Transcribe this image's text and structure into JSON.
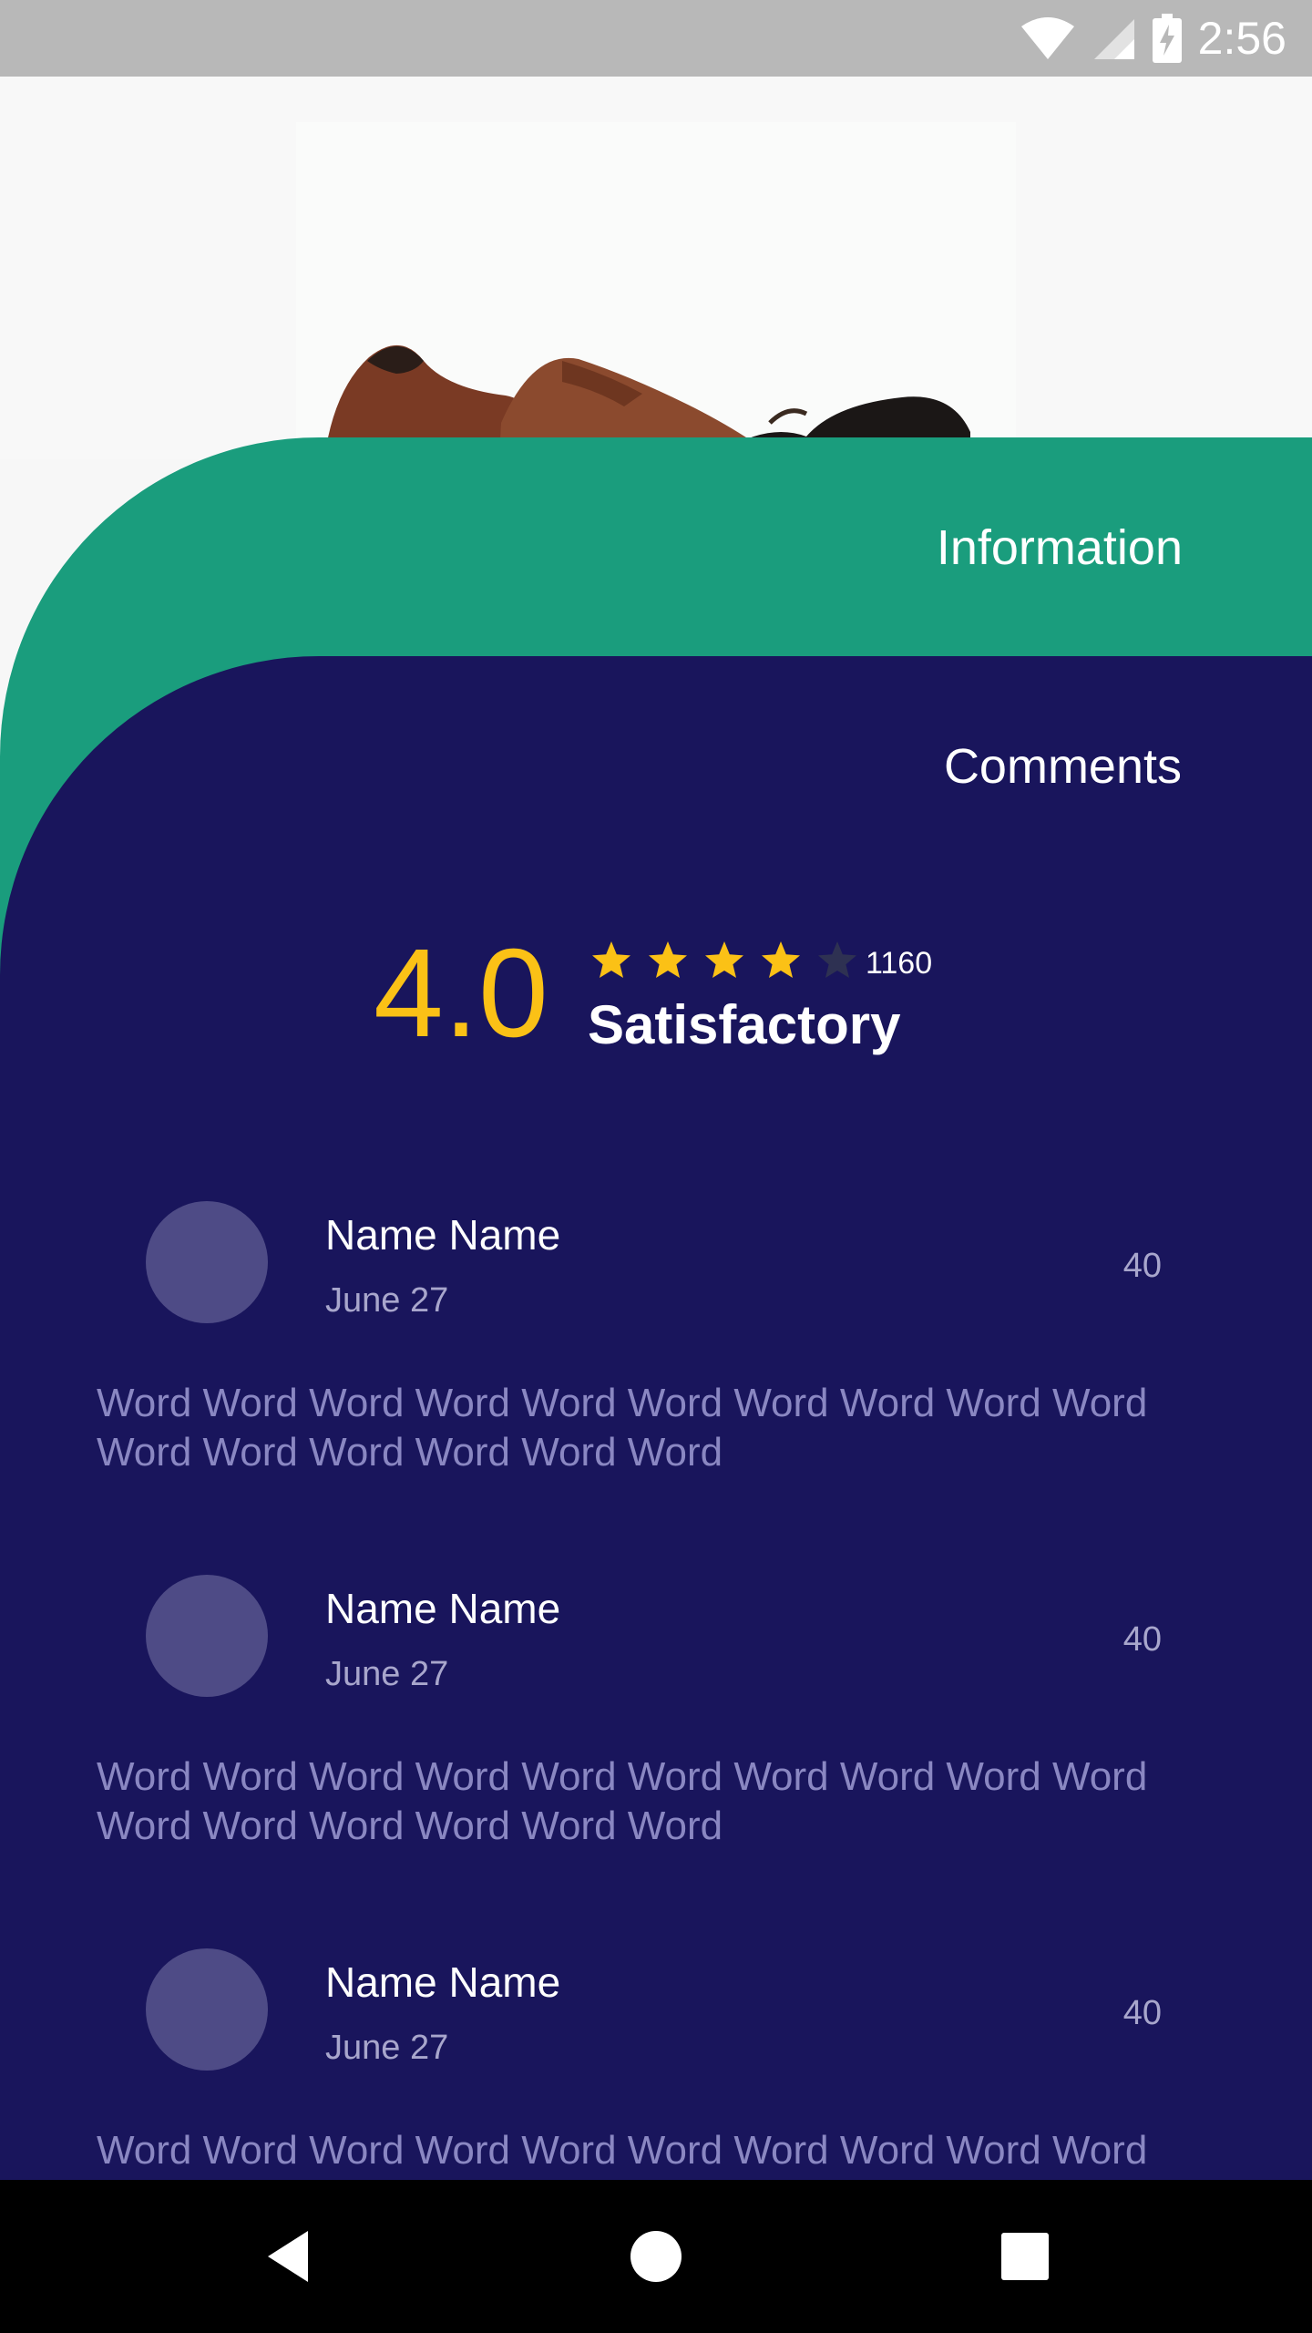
{
  "status_bar": {
    "time": "2:56",
    "icons": [
      "wifi-icon",
      "signal-icon",
      "battery-charging-icon"
    ]
  },
  "product": {
    "image": "brown-leather-shoes-image"
  },
  "tabs": {
    "information": "Information",
    "comments": "Comments"
  },
  "colors": {
    "information_panel": "#1a9d7d",
    "comments_panel": "#19155c",
    "rating_accent": "#fbc116",
    "star_empty": "#2e3152",
    "avatar": "#4e4b86"
  },
  "rating": {
    "score": "4.0",
    "stars_filled": 4,
    "stars_total": 5,
    "count": "1160",
    "label": "Satisfactory"
  },
  "comments": [
    {
      "name": "Name Name",
      "date": "June 27",
      "count": "40",
      "text": "Word Word Word Word Word Word Word Word Word Word Word Word Word Word Word Word"
    },
    {
      "name": "Name Name",
      "date": "June 27",
      "count": "40",
      "text": "Word Word Word Word Word Word Word Word Word Word Word Word Word Word Word Word"
    },
    {
      "name": "Name Name",
      "date": "June 27",
      "count": "40",
      "text": "Word Word Word Word Word Word Word Word Word Word"
    }
  ],
  "nav": {
    "buttons": [
      "back-icon",
      "home-icon",
      "recents-icon"
    ]
  }
}
